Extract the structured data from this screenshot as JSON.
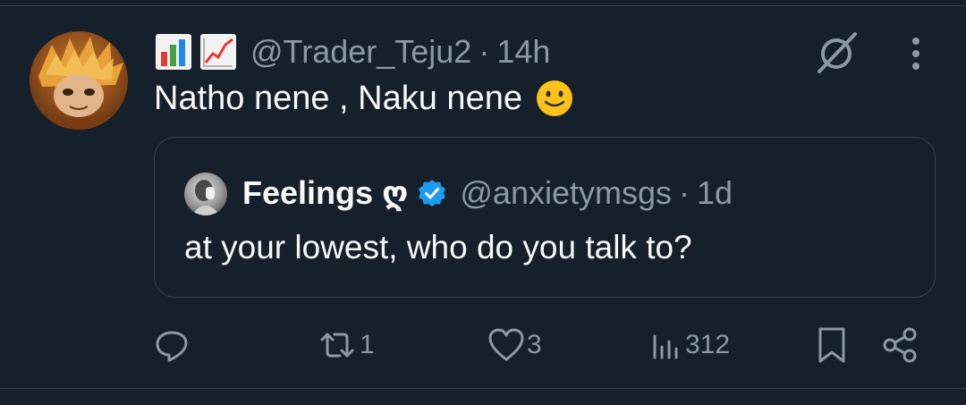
{
  "tweet": {
    "emojis": [
      "bar-chart-emoji",
      "chart-increasing-emoji"
    ],
    "handle": "@Trader_Teju2",
    "separator": "·",
    "time": "14h",
    "text": "Natho nene , Naku nene",
    "trailing_emoji": "slightly-smiling-face-emoji"
  },
  "quoted": {
    "name": "Feelings ღ",
    "verified": true,
    "handle": "@anxietymsgs",
    "separator": "·",
    "time": "1d",
    "text": "at your lowest, who do you talk to?"
  },
  "actions": {
    "reply_count": "",
    "retweet_count": "1",
    "like_count": "3",
    "views_count": "312"
  },
  "colors": {
    "background": "#15202b",
    "border": "#38444d",
    "text_primary": "#f7f9f9",
    "text_secondary": "#8b98a5",
    "verified_blue": "#1d9bf0"
  }
}
